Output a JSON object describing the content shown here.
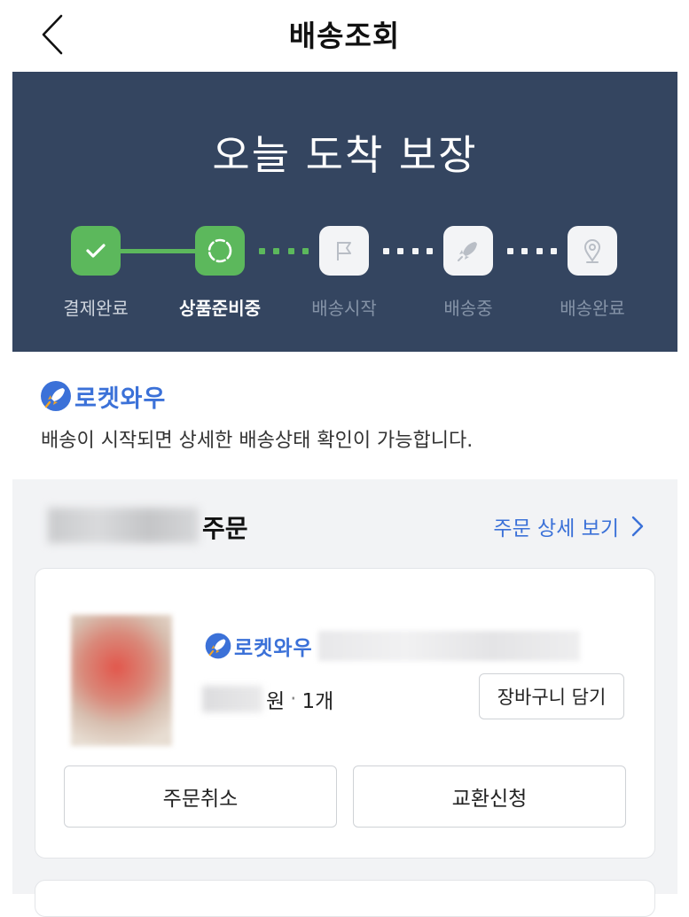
{
  "header": {
    "title": "배송조회",
    "back_icon": "chevron-left-icon"
  },
  "banner": {
    "title": "오늘 도착 보장",
    "steps": [
      {
        "label": "결제완료",
        "state": "done",
        "icon": "check-icon"
      },
      {
        "label": "상품준비중",
        "state": "current",
        "icon": "progress-ring-icon"
      },
      {
        "label": "배송시작",
        "state": "todo",
        "icon": "flag-icon"
      },
      {
        "label": "배송중",
        "state": "todo",
        "icon": "rocket-icon"
      },
      {
        "label": "배송완료",
        "state": "todo",
        "icon": "location-pin-icon"
      }
    ],
    "colors": {
      "bg": "#344560",
      "done": "#5cb85c",
      "todo": "#f3f4f6"
    }
  },
  "rocket": {
    "brand": "로켓와우",
    "info": "배송이 시작되면 상세한 배송상태 확인이 가능합니다."
  },
  "order": {
    "title_suffix": "주문",
    "detail_link": "주문 상세 보기",
    "item": {
      "brand": "로켓와우",
      "price_unit": "원",
      "separator": "·",
      "quantity": "1개",
      "cart_button": "장바구니 담기"
    },
    "actions": {
      "cancel": "주문취소",
      "exchange": "교환신청"
    },
    "accent": "#3b71d8"
  }
}
